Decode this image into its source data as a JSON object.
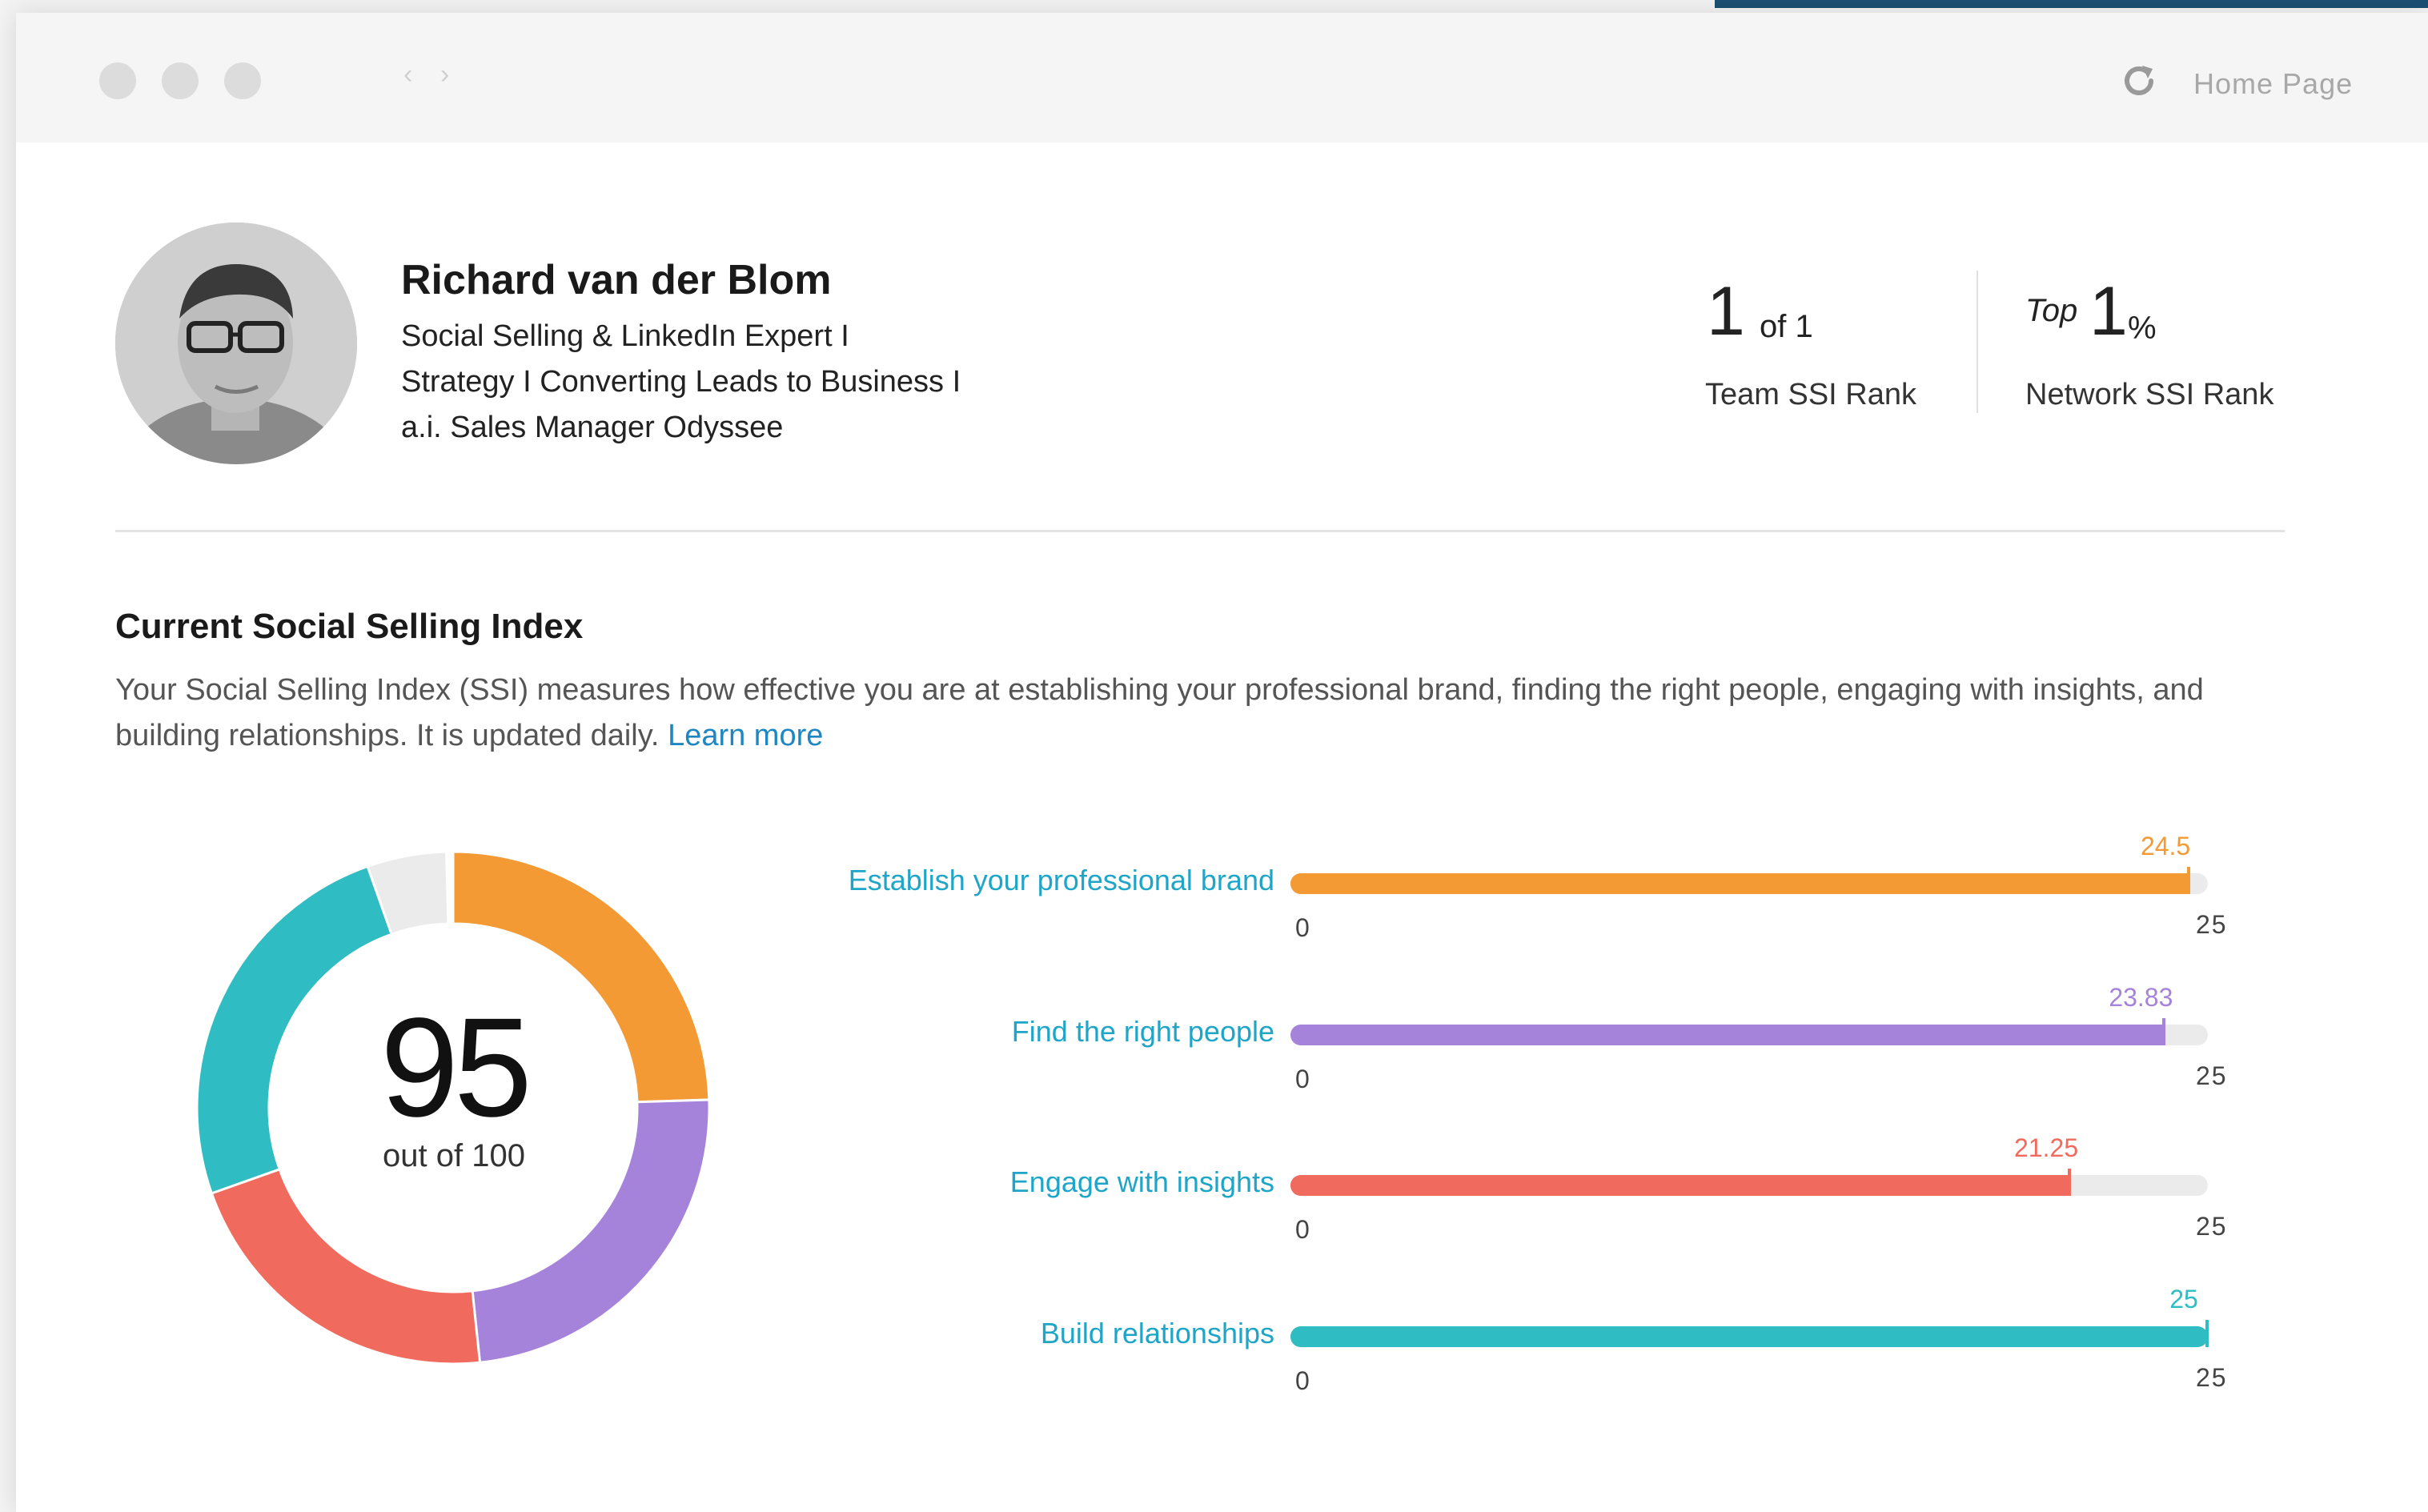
{
  "titlebar": {
    "back_icon": "chevron-left-icon",
    "forward_icon": "chevron-right-icon",
    "reload_icon": "reload-icon",
    "home_label": "Home Page"
  },
  "profile": {
    "name": "Richard van der Blom",
    "headline_lines": [
      "Social Selling & LinkedIn Expert I",
      "Strategy I Converting Leads to Business I",
      "a.i. Sales Manager Odyssee"
    ],
    "avatar": "profile-photo"
  },
  "ranks": {
    "team": {
      "value": "1",
      "suffix": "of 1",
      "label": "Team SSI Rank"
    },
    "network": {
      "prefix": "Top",
      "value": "1",
      "suffix": "%",
      "label": "Network SSI Rank"
    }
  },
  "ssi": {
    "title": "Current Social Selling Index",
    "description": "Your Social Selling Index (SSI) measures how effective you are at establishing your professional brand, finding the right people, engaging with insights, and building relationships. It is updated daily. ",
    "learn_more": "Learn more",
    "score": "95",
    "score_sub": "out of 100"
  },
  "colors": {
    "brand": "#F39A34",
    "people": "#A683DB",
    "insights": "#F06B5E",
    "relationships": "#2FBCC2",
    "remainder": "#EBEBEB",
    "link": "#1E86C0"
  },
  "chart_data": {
    "type": "bar",
    "orientation": "horizontal",
    "categories": [
      "Establish your professional brand",
      "Find the right people",
      "Engage with insights",
      "Build relationships"
    ],
    "values": [
      24.5,
      23.83,
      21.25,
      25
    ],
    "value_labels": [
      "24.5",
      "23.83",
      "21.25",
      "25"
    ],
    "xlim": [
      0,
      25
    ],
    "axis_min_label": "0",
    "axis_max_label": "25",
    "total": 95,
    "total_max": 100
  }
}
